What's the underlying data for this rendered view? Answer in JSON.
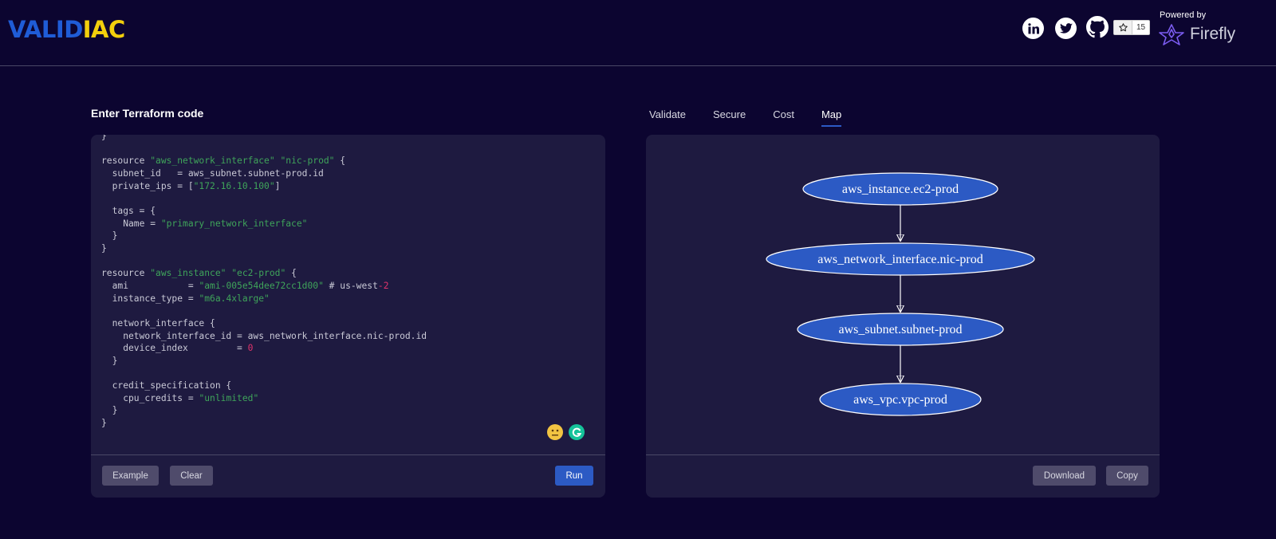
{
  "header": {
    "logo_part1": "VALID",
    "logo_part2": "IAC",
    "github_stars": "15",
    "powered_by": "Powered by",
    "firefly_brand": "Firefly",
    "icons": [
      "linkedin-icon",
      "twitter-icon",
      "github-icon",
      "star-icon",
      "firefly-logo-icon"
    ]
  },
  "editor": {
    "title": "Enter Terraform code",
    "code_lines": [
      [
        {
          "t": "}"
        }
      ],
      [
        {
          "t": ""
        }
      ],
      [
        {
          "t": "resource "
        },
        {
          "t": "\"aws_network_interface\"",
          "c": "s"
        },
        {
          "t": " "
        },
        {
          "t": "\"nic-prod\"",
          "c": "s"
        },
        {
          "t": " {"
        }
      ],
      [
        {
          "t": "  subnet_id   = aws_subnet.subnet-prod.id"
        }
      ],
      [
        {
          "t": "  private_ips = ["
        },
        {
          "t": "\"172.16.10.100\"",
          "c": "s"
        },
        {
          "t": "]"
        }
      ],
      [
        {
          "t": ""
        }
      ],
      [
        {
          "t": "  tags = {"
        }
      ],
      [
        {
          "t": "    Name = "
        },
        {
          "t": "\"primary_network_interface\"",
          "c": "s"
        }
      ],
      [
        {
          "t": "  }"
        }
      ],
      [
        {
          "t": "}"
        }
      ],
      [
        {
          "t": ""
        }
      ],
      [
        {
          "t": "resource "
        },
        {
          "t": "\"aws_instance\"",
          "c": "s"
        },
        {
          "t": " "
        },
        {
          "t": "\"ec2-prod\"",
          "c": "s"
        },
        {
          "t": " {"
        }
      ],
      [
        {
          "t": "  ami           = "
        },
        {
          "t": "\"ami-005e54dee72cc1d00\"",
          "c": "s"
        },
        {
          "t": " # us-west"
        },
        {
          "t": "-2",
          "c": "n"
        }
      ],
      [
        {
          "t": "  instance_type = "
        },
        {
          "t": "\"m6a.4xlarge\"",
          "c": "s"
        }
      ],
      [
        {
          "t": ""
        }
      ],
      [
        {
          "t": "  network_interface {"
        }
      ],
      [
        {
          "t": "    network_interface_id = aws_network_interface.nic-prod.id"
        }
      ],
      [
        {
          "t": "    device_index         = "
        },
        {
          "t": "0",
          "c": "n"
        }
      ],
      [
        {
          "t": "  }"
        }
      ],
      [
        {
          "t": ""
        }
      ],
      [
        {
          "t": "  credit_specification {"
        }
      ],
      [
        {
          "t": "    cpu_credits = "
        },
        {
          "t": "\"unlimited\"",
          "c": "s"
        }
      ],
      [
        {
          "t": "  }"
        }
      ],
      [
        {
          "t": "}"
        }
      ]
    ],
    "example_label": "Example",
    "clear_label": "Clear",
    "run_label": "Run"
  },
  "tabs": [
    {
      "label": "Validate",
      "active": false
    },
    {
      "label": "Secure",
      "active": false
    },
    {
      "label": "Cost",
      "active": false
    },
    {
      "label": "Map",
      "active": true
    }
  ],
  "map": {
    "nodes": [
      "aws_instance.ec2-prod",
      "aws_network_interface.nic-prod",
      "aws_subnet.subnet-prod",
      "aws_vpc.vpc-prod"
    ],
    "download_label": "Download",
    "copy_label": "Copy"
  },
  "colors": {
    "background": "#0c0530",
    "panel": "#1e1a40",
    "accent": "#2c5ac4",
    "node_fill": "#2c5ac4",
    "string": "#3fa45a",
    "number": "#e0336b"
  }
}
